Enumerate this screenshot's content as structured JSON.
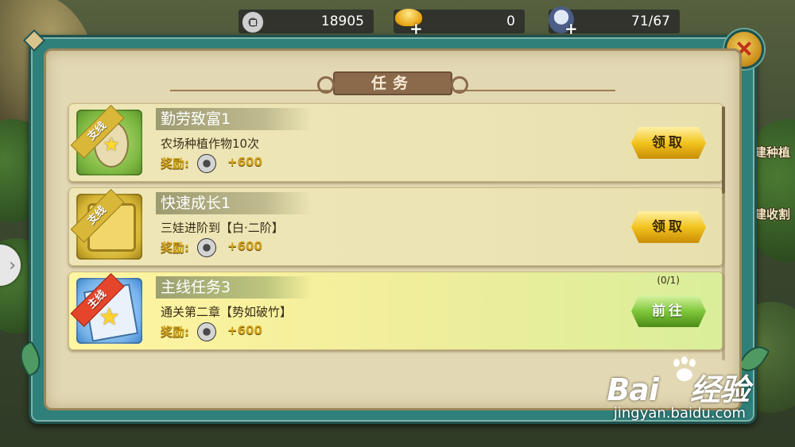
{
  "resources": {
    "coins": "18905",
    "gold": "0",
    "stamina": "71/67"
  },
  "side_labels": [
    "建种植",
    "建收割"
  ],
  "dialog": {
    "title": "任务",
    "tasks": [
      {
        "category": "支线",
        "title": "勤劳致富1",
        "description": "农场种植作物10次",
        "reward_label": "奖励:",
        "reward_value": "+600",
        "button": "领取",
        "button_style": "claim",
        "icon": "egg-star-icon"
      },
      {
        "category": "支线",
        "title": "快速成长1",
        "description": "三娃进阶到【白·二阶】",
        "reward_label": "奖励:",
        "reward_value": "+600",
        "button": "领取",
        "button_style": "claim",
        "icon": "gift-box-icon"
      },
      {
        "category": "主线",
        "title": "主线任务3",
        "description": "通关第二章【势如破竹】",
        "reward_label": "奖励:",
        "reward_value": "+600",
        "button": "前往",
        "button_style": "go",
        "progress": "(0/1)",
        "icon": "map-star-icon"
      }
    ]
  },
  "watermark": {
    "brand": "Bai",
    "brand_suffix": "经验",
    "url": "jingyan.baidu.com"
  },
  "colors": {
    "dialog_frame": "#2f7f7a",
    "panel": "#e2d8b3",
    "claim_button": "#f2c41e",
    "go_button": "#7fc73b",
    "reward_gold": "#d0a21e",
    "close_red": "#c0321b"
  }
}
